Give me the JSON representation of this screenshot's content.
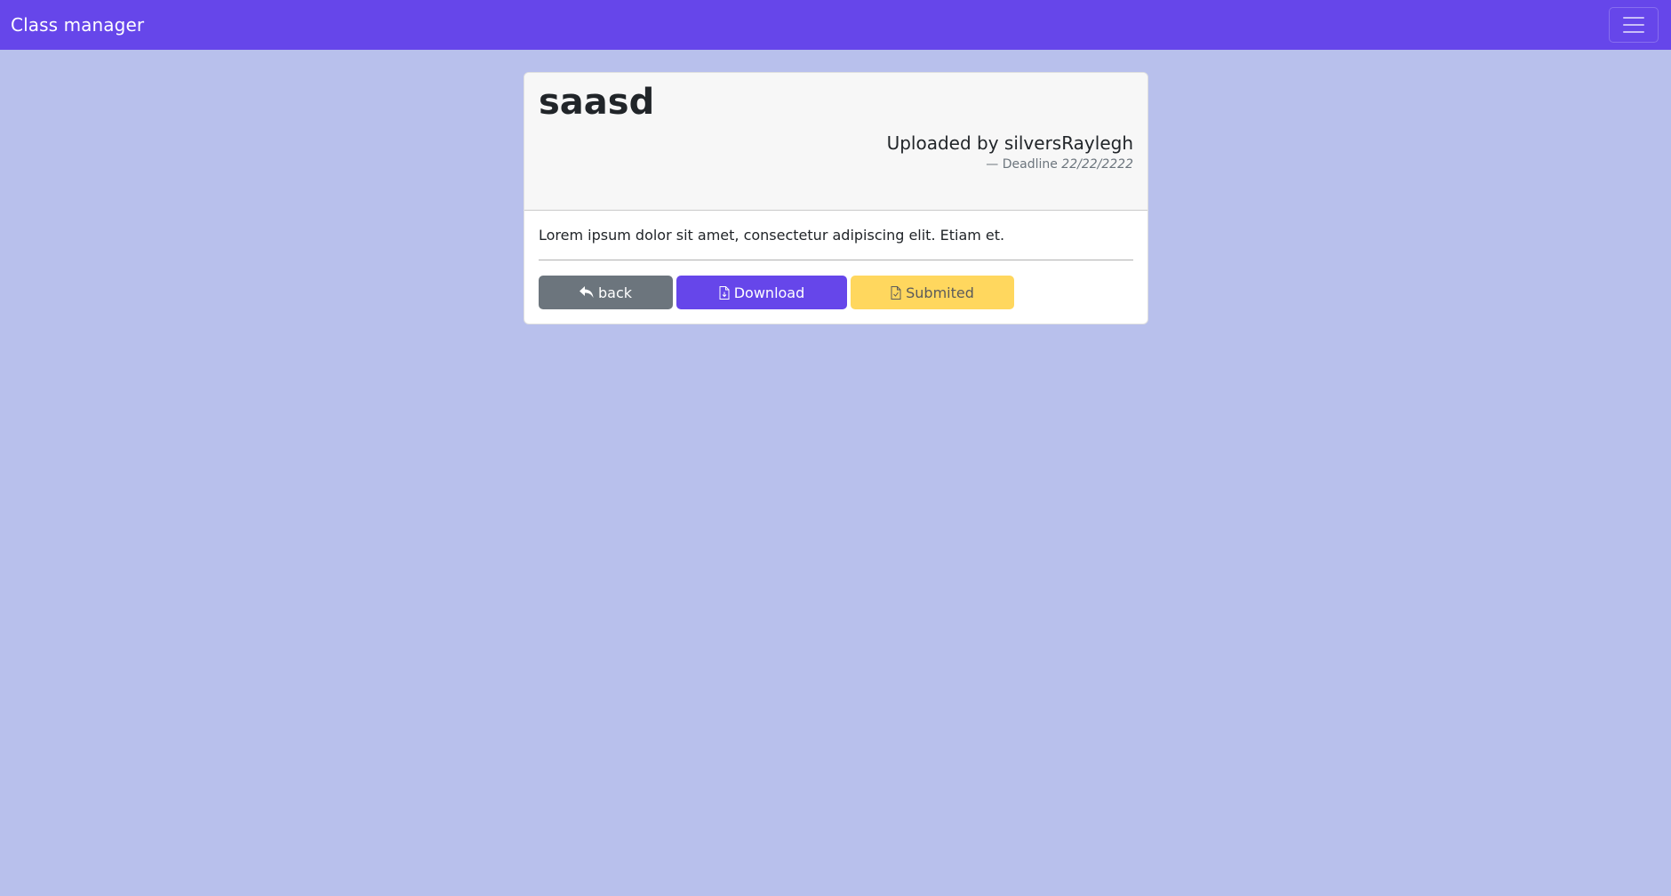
{
  "navbar": {
    "brand": "Class manager",
    "menu_icon": "hamburger-menu-icon"
  },
  "assignment": {
    "title": "saasd",
    "uploaded_by": "Uploaded by silversRaylegh",
    "deadline_dash": "—",
    "deadline_label": "Deadline",
    "deadline_date": "22/22/2222",
    "description": "Lorem ipsum dolor sit amet, consectetur adipiscing elit. Etiam et."
  },
  "actions": {
    "back_label": "back",
    "back_icon": "reply-arrow-icon",
    "download_label": "Download",
    "download_icon": "file-download-icon",
    "submit_label": "Submited",
    "submit_icon": "file-icon"
  },
  "colors": {
    "navbar": "#6646ea",
    "page_background": "#b8c0ec",
    "back_button": "#6c757d",
    "download_button": "#6646ea",
    "submit_button": "#ffd75e"
  }
}
